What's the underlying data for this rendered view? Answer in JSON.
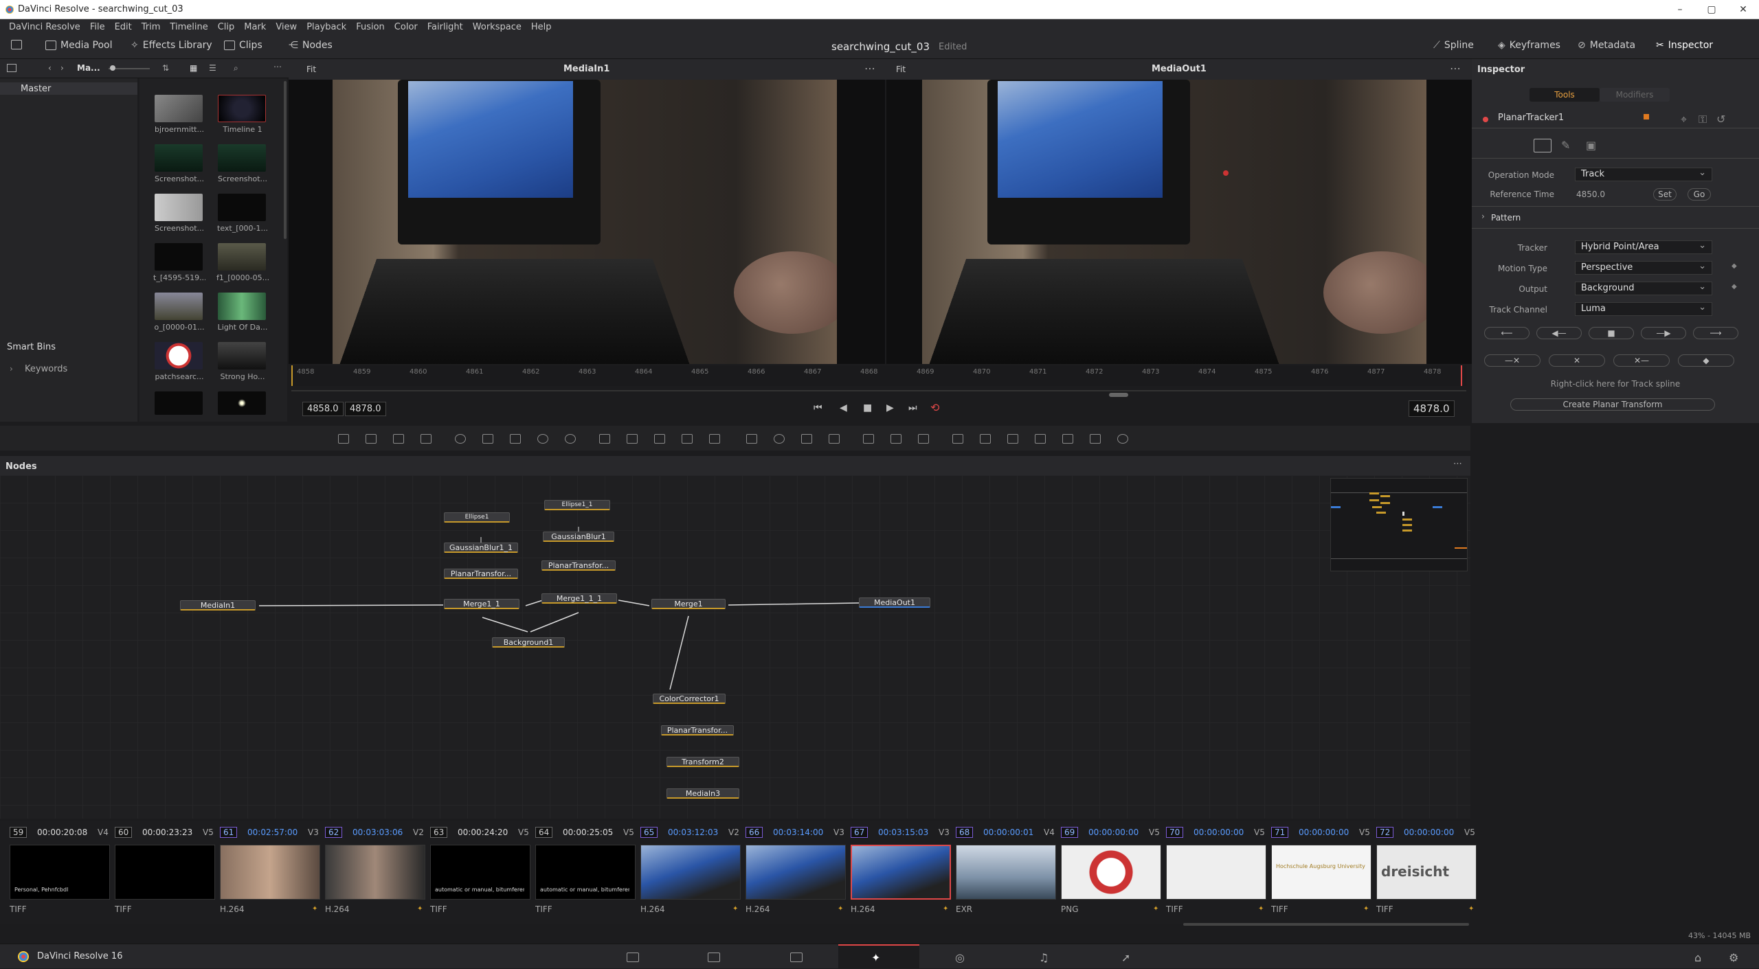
{
  "window": {
    "title": "DaVinci Resolve - searchwing_cut_03",
    "controls": [
      "–",
      "▢",
      "✕"
    ]
  },
  "menu": [
    "DaVinci Resolve",
    "File",
    "Edit",
    "Trim",
    "Timeline",
    "Clip",
    "Mark",
    "View",
    "Playback",
    "Fusion",
    "Color",
    "Fairlight",
    "Workspace",
    "Help"
  ],
  "toolbar": {
    "media_pool": "Media Pool",
    "effects_library": "Effects Library",
    "clips": "Clips",
    "nodes": "Nodes",
    "project": "searchwing_cut_03",
    "edited": "Edited",
    "spline": "Spline",
    "keyframes": "Keyframes",
    "metadata": "Metadata",
    "inspector": "Inspector"
  },
  "media_pool": {
    "bin_dropdown": "Ma...",
    "bin_master": "Master",
    "smart_bins": "Smart Bins",
    "keywords": "Keywords",
    "items": [
      {
        "label": "bjroernmitt..."
      },
      {
        "label": "Timeline 1"
      },
      {
        "label": "Screenshot..."
      },
      {
        "label": "Screenshot..."
      },
      {
        "label": "Screenshot..."
      },
      {
        "label": "text_[000-1..."
      },
      {
        "label": "t_[4595-519..."
      },
      {
        "label": "f1_[0000-05..."
      },
      {
        "label": "o_[0000-01..."
      },
      {
        "label": "Light Of Da..."
      },
      {
        "label": "patchsearc..."
      },
      {
        "label": "Strong Ho..."
      }
    ]
  },
  "viewer_left": {
    "title": "MediaIn1",
    "fit": "Fit"
  },
  "viewer_right": {
    "title": "MediaOut1",
    "fit": "Fit"
  },
  "ruler_ticks": [
    "4858",
    "4859",
    "4860",
    "4861",
    "4862",
    "4863",
    "4864",
    "4865",
    "4866",
    "4867",
    "4868",
    "4869",
    "4870",
    "4871",
    "4872",
    "4873",
    "4874",
    "4875",
    "4876",
    "4877",
    "4878"
  ],
  "transport": {
    "start": "4858.0",
    "end": "4878.0",
    "current": "4878.0"
  },
  "inspector": {
    "title": "Inspector",
    "tab_tools": "Tools",
    "tab_modifiers": "Modifiers",
    "node_name": "PlanarTracker1",
    "operation_mode_label": "Operation Mode",
    "operation_mode": "Track",
    "reference_time_label": "Reference Time",
    "reference_time": "4850.0",
    "set": "Set",
    "go": "Go",
    "pattern": "Pattern",
    "tracker_label": "Tracker",
    "tracker": "Hybrid Point/Area",
    "motion_type_label": "Motion Type",
    "motion_type": "Perspective",
    "output_label": "Output",
    "output": "Background",
    "track_channel_label": "Track Channel",
    "track_channel": "Luma",
    "spline_hint": "Right-click here for Track spline",
    "create_btn": "Create Planar Transform"
  },
  "nodes_panel": {
    "title": "Nodes",
    "nodes": [
      {
        "name": "Ellipse1"
      },
      {
        "name": "Ellipse1_1"
      },
      {
        "name": "GaussianBlur1_1"
      },
      {
        "name": "GaussianBlur1"
      },
      {
        "name": "PlanarTransfor..."
      },
      {
        "name": "PlanarTransfor..."
      },
      {
        "name": "MediaIn1"
      },
      {
        "name": "Merge1_1"
      },
      {
        "name": "Merge1_1_1"
      },
      {
        "name": "Merge1"
      },
      {
        "name": "MediaOut1"
      },
      {
        "name": "Background1"
      },
      {
        "name": "ColorCorrector1"
      },
      {
        "name": "PlanarTransfor..."
      },
      {
        "name": "Transform2"
      },
      {
        "name": "MediaIn3"
      }
    ]
  },
  "clips": [
    {
      "num": "59",
      "tc": "00:00:20:08",
      "track": "V4",
      "fmt": "TIFF",
      "blue": false,
      "caption": "Personal, Pehnfcbdl"
    },
    {
      "num": "60",
      "tc": "00:00:23:23",
      "track": "V5",
      "fmt": "TIFF",
      "blue": false,
      "caption": ""
    },
    {
      "num": "61",
      "tc": "00:02:57:00",
      "track": "V3",
      "fmt": "H.264",
      "blue": true,
      "caption": ""
    },
    {
      "num": "62",
      "tc": "00:03:03:06",
      "track": "V2",
      "fmt": "H.264",
      "blue": true,
      "caption": ""
    },
    {
      "num": "63",
      "tc": "00:00:24:20",
      "track": "V5",
      "fmt": "TIFF",
      "blue": false,
      "caption": "automatic or manual, bitumferenz"
    },
    {
      "num": "64",
      "tc": "00:00:25:05",
      "track": "V5",
      "fmt": "TIFF",
      "blue": false,
      "caption": "automatic or manual, bitumferenz"
    },
    {
      "num": "65",
      "tc": "00:03:12:03",
      "track": "V2",
      "fmt": "H.264",
      "blue": true,
      "caption": ""
    },
    {
      "num": "66",
      "tc": "00:03:14:00",
      "track": "V3",
      "fmt": "H.264",
      "blue": true,
      "caption": ""
    },
    {
      "num": "67",
      "tc": "00:03:15:03",
      "track": "V3",
      "fmt": "H.264",
      "blue": true,
      "caption": ""
    },
    {
      "num": "68",
      "tc": "00:00:00:01",
      "track": "V4",
      "fmt": "EXR",
      "blue": true,
      "caption": ""
    },
    {
      "num": "69",
      "tc": "00:00:00:00",
      "track": "V5",
      "fmt": "PNG",
      "blue": true,
      "caption": ""
    },
    {
      "num": "70",
      "tc": "00:00:00:00",
      "track": "V5",
      "fmt": "TIFF",
      "blue": true,
      "caption": ""
    },
    {
      "num": "71",
      "tc": "00:00:00:00",
      "track": "V5",
      "fmt": "TIFF",
      "blue": true,
      "caption": "Hochschule Augsburg University of Applied Sciences"
    },
    {
      "num": "72",
      "tc": "00:00:00:00",
      "track": "V5",
      "fmt": "TIFF",
      "blue": true,
      "caption": "dreisicht"
    }
  ],
  "status": {
    "memory": "43% - 14045 MB",
    "app": "DaVinci Resolve 16"
  },
  "colors": {
    "accent": "#d6a02a",
    "selected_clip": "#e04848",
    "tc_blue": "#5a9cff"
  }
}
